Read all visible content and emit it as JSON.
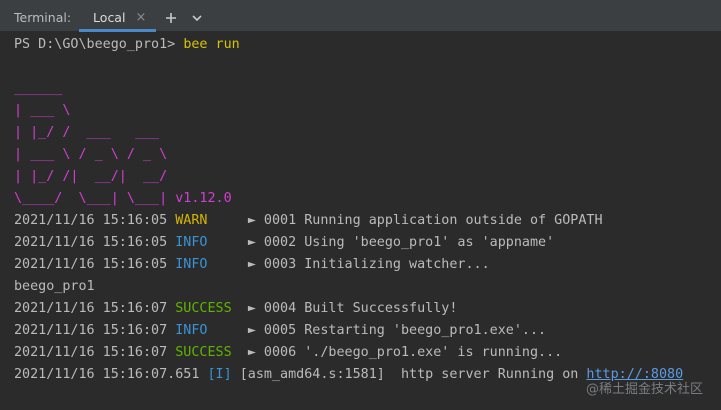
{
  "tab_bar": {
    "title": "Terminal:",
    "active_tab": "Local",
    "close_glyph": "×",
    "add_glyph": "+",
    "icons": [
      "close-icon",
      "plus-icon",
      "chevron-down-icon"
    ]
  },
  "prompt": {
    "text": "PS D:\\GO\\beego_pro1> ",
    "command": "bee run"
  },
  "banner": {
    "lines": [
      "______",
      "| ___ \\",
      "| |_/ /  ___   ___",
      "| ___ \\ / _ \\ / _ \\",
      "| |_/ /|  __/|  __/",
      "\\____/  \\___| \\___|"
    ],
    "version": " v1.12.0"
  },
  "logs": [
    {
      "ts": "2021/11/16 15:16:05 ",
      "level": "WARN",
      "pad": "     ",
      "msg": "► 0001 Running application outside of GOPATH"
    },
    {
      "ts": "2021/11/16 15:16:05 ",
      "level": "INFO",
      "pad": "     ",
      "msg": "► 0002 Using 'beego_pro1' as 'appname'"
    },
    {
      "ts": "2021/11/16 15:16:05 ",
      "level": "INFO",
      "pad": "     ",
      "msg": "► 0003 Initializing watcher..."
    },
    {
      "ts": "2021/11/16 15:16:07 ",
      "level": "SUCCESS",
      "pad": "  ",
      "msg": "► 0004 Built Successfully!"
    },
    {
      "ts": "2021/11/16 15:16:07 ",
      "level": "INFO",
      "pad": "     ",
      "msg": "► 0005 Restarting 'beego_pro1.exe'..."
    },
    {
      "ts": "2021/11/16 15:16:07 ",
      "level": "SUCCESS",
      "pad": "  ",
      "msg": "► 0006 './beego_pro1.exe' is running..."
    }
  ],
  "app_name_line": "beego_pro1",
  "server_line": {
    "ts": "2021/11/16 15:16:07.651 ",
    "tag": "[I]",
    "source": " [asm_amd64.s:1581]  http server Running on ",
    "url": "http://:8080"
  },
  "watermark": "@稀土掘金技术社区",
  "colors": {
    "background": "#2b2b2b",
    "ascii_art": "#d33ed2",
    "warn": "#d4b500",
    "info": "#3993d4",
    "success": "#5fb500",
    "command": "#d6c600",
    "tab_accent": "#4a88c7"
  }
}
